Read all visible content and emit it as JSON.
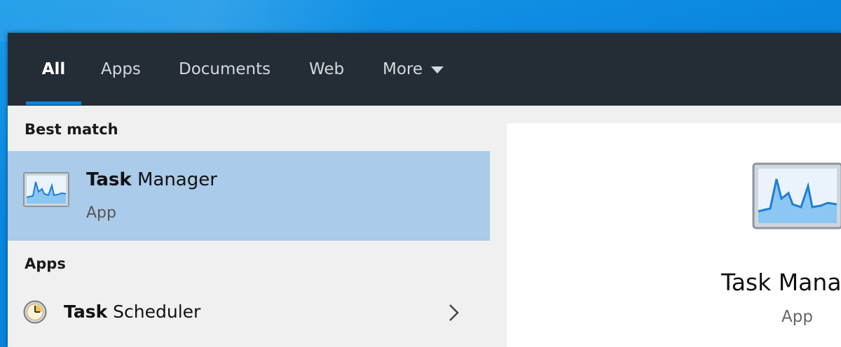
{
  "tabs": [
    {
      "label": "All",
      "active": true
    },
    {
      "label": "Apps",
      "active": false
    },
    {
      "label": "Documents",
      "active": false
    },
    {
      "label": "Web",
      "active": false
    },
    {
      "label": "More",
      "active": false
    }
  ],
  "best_match": {
    "section_label": "Best match",
    "title_bold": "Task",
    "title_rest": " Manager",
    "subtitle": "App",
    "icon": "task-manager-icon"
  },
  "apps_section": {
    "section_label": "Apps",
    "items": [
      {
        "title_bold": "Task",
        "title_rest": " Scheduler",
        "icon": "task-scheduler-icon"
      }
    ]
  },
  "preview": {
    "title": "Task Manager",
    "subtitle": "App",
    "icon": "task-manager-icon"
  },
  "colors": {
    "tab_bar_bg": "#242d35",
    "accent": "#0a84e0",
    "selected_bg": "#aacbe9",
    "list_bg": "#f0f0f0"
  }
}
